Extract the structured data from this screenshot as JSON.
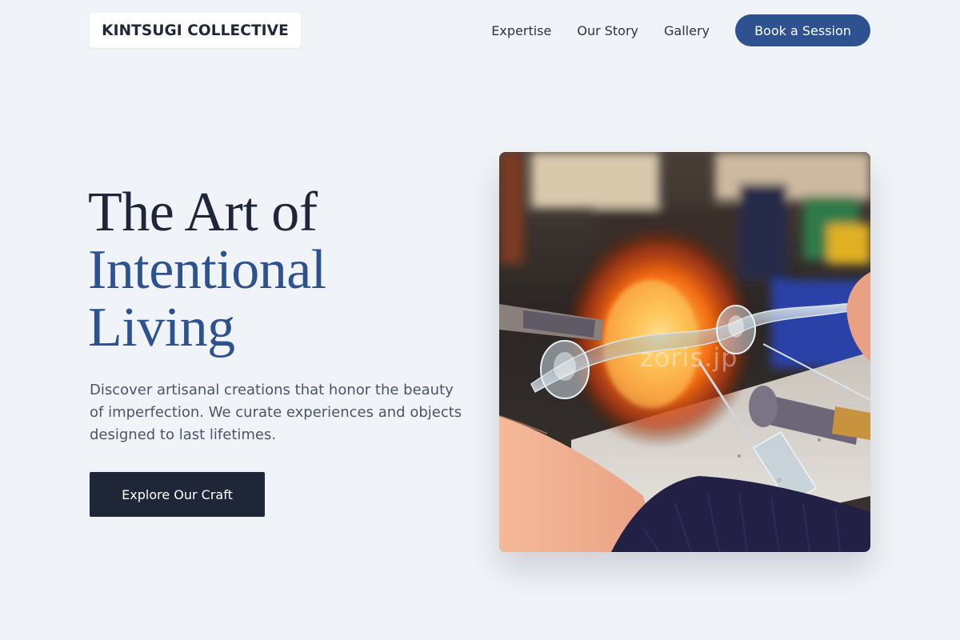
{
  "brand": {
    "name": "KINTSUGI COLLECTIVE"
  },
  "nav": {
    "items": [
      {
        "label": "Expertise"
      },
      {
        "label": "Our Story"
      },
      {
        "label": "Gallery"
      }
    ],
    "cta_label": "Book a Session"
  },
  "hero": {
    "title_line1": "The Art of",
    "title_line2": "Intentional",
    "title_line3": "Living",
    "description": "Discover artisanal creations that honor the beauty of imperfection. We curate experiences and objects designed to last lifetimes.",
    "button_label": "Explore Our Craft",
    "image_watermark": "zoris.jp"
  },
  "colors": {
    "background": "#f0f3f7",
    "primary_dark": "#1e2637",
    "accent_blue": "#2e5290",
    "body_text": "#4b5568"
  }
}
